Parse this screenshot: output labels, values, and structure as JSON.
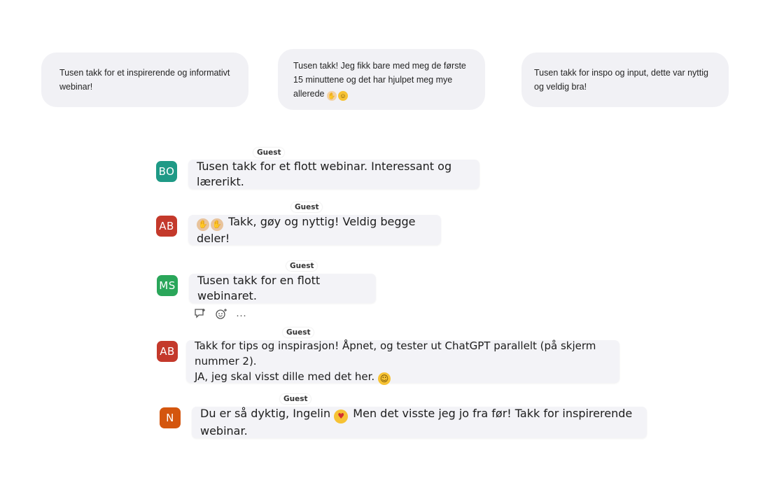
{
  "top_cards": [
    {
      "text": "Tusen takk for et inspirerende og informativt webinar!"
    },
    {
      "text": "Tusen takk! Jeg fikk bare med meg de første 15 minuttene og det har hjulpet meg mye allerede",
      "emoji_1": "🙏",
      "emoji_2": "😊"
    },
    {
      "text": "Tusen takk for inspo og input, dette var nyttig og veldig bra!"
    }
  ],
  "messages": [
    {
      "initials": "BO",
      "avatar_color": "#1f9a86",
      "tag": "Guest",
      "text": "Tusen takk for et flott webinar. Interessant og lærerikt."
    },
    {
      "initials": "AB",
      "avatar_color": "#c4392b",
      "tag": "Guest",
      "emoji": "👏👏",
      "text": "Takk, gøy og nyttig! Veldig begge deler!"
    },
    {
      "initials": "MS",
      "avatar_color": "#2aa65a",
      "tag": "Guest",
      "text": "Tusen takk for en flott webinaret."
    },
    {
      "initials": "AB",
      "avatar_color": "#c4392b",
      "tag": "Guest",
      "line1": "Takk for tips og inspirasjon! Åpnet, og tester ut ChatGPT parallelt (på skjerm nummer 2).",
      "line2": "JA, jeg skal visst dille med det her.",
      "emoji": "😁"
    },
    {
      "initials": "N",
      "avatar_color": "#d4560e",
      "tag": "Guest",
      "text_before": "Du er så dyktig, Ingelin",
      "emoji": "😍",
      "text_after": "Men det visste jeg jo fra før! Takk for inspirerende webinar."
    }
  ],
  "message_actions": {
    "reply_icon": "reply-icon",
    "react_icon": "add-reaction-icon",
    "more_label": "···"
  }
}
